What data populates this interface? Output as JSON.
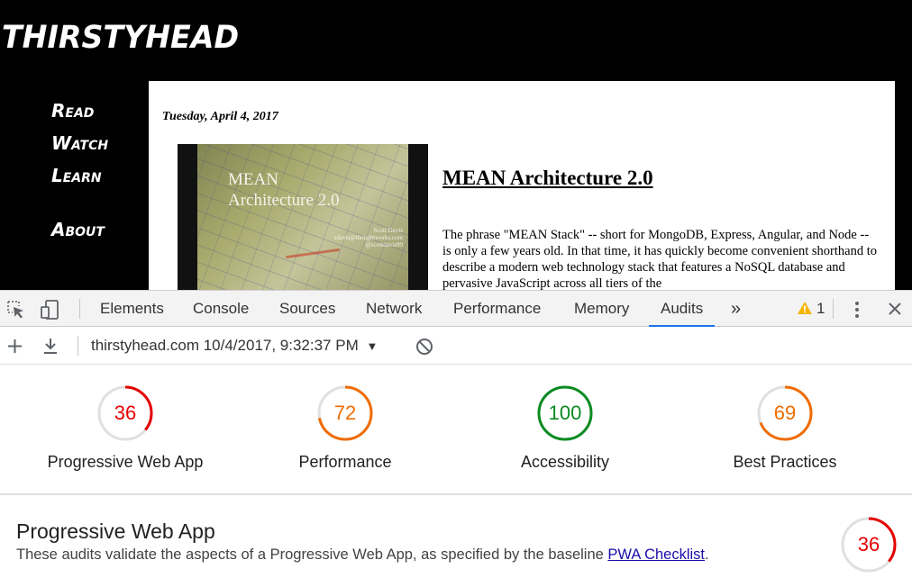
{
  "site": {
    "title": "THIRSTYHEAD",
    "nav": [
      "Read",
      "Watch",
      "Learn",
      "About"
    ],
    "post": {
      "date": "Tuesday, April 4, 2017",
      "image_title_line1": "MEAN",
      "image_title_line2": "Architecture 2.0",
      "image_author_lines": [
        "Scott Davis",
        "sdavis@thoughtworks.com",
        "@scottdavis99"
      ],
      "heading": "MEAN Architecture 2.0",
      "body": "The phrase \"MEAN Stack\" -- short for MongoDB, Express, Angular, and Node -- is only a few years old. In that time, it has quickly become convenient shorthand to describe a modern web technology stack that features a NoSQL database and pervasive JavaScript across all tiers of the"
    }
  },
  "devtools": {
    "tabs": [
      "Elements",
      "Console",
      "Sources",
      "Network",
      "Performance",
      "Memory",
      "Audits"
    ],
    "active_tab": "Audits",
    "overflow": "»",
    "warning_count": "1",
    "icons": {
      "inspect": "inspect-element-icon",
      "device": "device-toolbar-icon",
      "warning": "warning-icon",
      "menu": "kebab-menu-icon",
      "close": "close-icon",
      "add": "plus-icon",
      "download": "download-icon",
      "dropdown": "triangle-down-icon",
      "clear": "clear-icon"
    },
    "report_label": "thirstyhead.com 10/4/2017, 9:32:37 PM",
    "dropdown_glyph": "▼",
    "scores": [
      {
        "label": "Progressive Web App",
        "score": 36,
        "color": "#e50000"
      },
      {
        "label": "Performance",
        "score": 72,
        "color": "#ef6c00"
      },
      {
        "label": "Accessibility",
        "score": 100,
        "color": "#0b8b22"
      },
      {
        "label": "Best Practices",
        "score": 69,
        "color": "#ef6c00"
      }
    ],
    "section": {
      "title": "Progressive Web App",
      "desc_prefix": "These audits validate the aspects of a Progressive Web App, as specified by the baseline ",
      "desc_link": "PWA Checklist",
      "desc_suffix": ".",
      "score": 36,
      "color": "#e50000"
    }
  }
}
